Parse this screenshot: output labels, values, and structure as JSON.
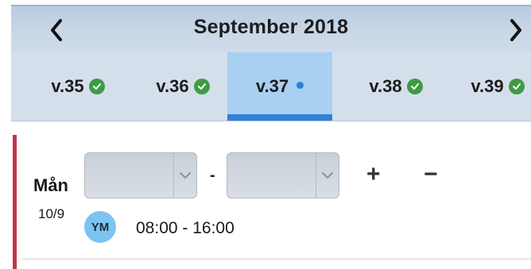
{
  "header": {
    "title": "September 2018",
    "back_icon": "chevron-left-icon",
    "forward_icon": "chevron-right-icon"
  },
  "weeks": [
    {
      "label": "v.35",
      "status": "done"
    },
    {
      "label": "v.36",
      "status": "done"
    },
    {
      "label": "v.37",
      "status": "current"
    },
    {
      "label": "v.38",
      "status": "done"
    },
    {
      "label": "v.39",
      "status": "done"
    }
  ],
  "entry": {
    "day": "Mån",
    "date": "10/9",
    "start_select_value": "",
    "end_select_value": "",
    "range_separator": "-",
    "add_label": "+",
    "remove_label": "−",
    "avatar_initials": "YM",
    "time": "08:00 - 16:00"
  },
  "colors": {
    "accent": "#2f80d7",
    "check": "#3f9b45",
    "avatar": "#7cc4ef",
    "left_accent": "#c5334b"
  }
}
